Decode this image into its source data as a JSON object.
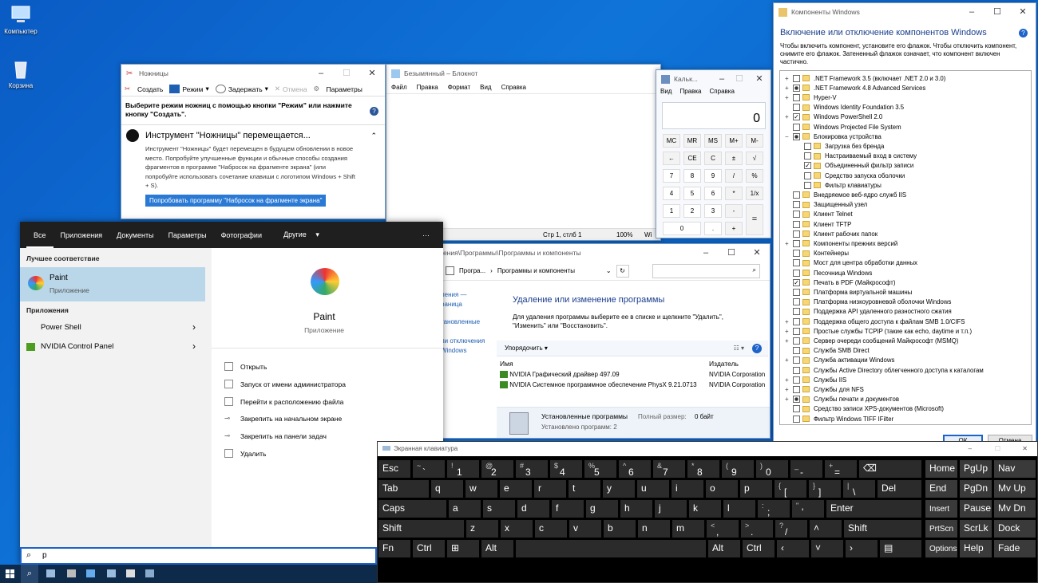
{
  "desktop": {
    "computer": "Компьютер",
    "recycle": "Корзина"
  },
  "snipping": {
    "title": "Ножницы",
    "create": "Создать",
    "mode": "Режим",
    "delay": "Задержать",
    "cancel": "Отмена",
    "options": "Параметры",
    "hint": "Выберите режим ножниц с помощью кнопки \"Режим\" или нажмите кнопку \"Создать\".",
    "moving_title": "Инструмент \"Ножницы\" перемещается...",
    "moving_text": "Инструмент \"Ножницы\" будет перемещен в будущем обновлении в новое место. Попробуйте улучшенные функции и обычные способы создания фрагментов в программе \"Набросок на фрагменте экрана\" (или попробуйте использовать сочетание клавиши с логотипом Windows + Shift + S).",
    "try_button": "Попробовать программу \"Набросок на фрагменте экрана\""
  },
  "notepad": {
    "title": "Безымянный – Блокнот",
    "menu": [
      "Файл",
      "Правка",
      "Формат",
      "Вид",
      "Справка"
    ],
    "status_pos": "Стр 1, стлб 1",
    "zoom": "100%",
    "enc": "Wi"
  },
  "calc": {
    "title": "Кальк...",
    "menu": [
      "Вид",
      "Правка",
      "Справка"
    ],
    "display": "0",
    "keys": [
      [
        "MC",
        "MR",
        "MS",
        "M+",
        "M-"
      ],
      [
        "←",
        "CE",
        "C",
        "±",
        "√"
      ],
      [
        "7",
        "8",
        "9",
        "/",
        "%"
      ],
      [
        "4",
        "5",
        "6",
        "*",
        "1/x"
      ],
      [
        "1",
        "2",
        "3",
        "-",
        "="
      ],
      [
        "0",
        ".",
        "+"
      ]
    ]
  },
  "features": {
    "title": "Компоненты Windows",
    "heading": "Включение или отключение компонентов Windows",
    "desc": "Чтобы включить компонент, установите его флажок. Чтобы отключить компонент, снимите его флажок. Затененный флажок означает, что компонент включен частично.",
    "ok": "ОК",
    "cancel": "Отмена",
    "items": [
      {
        "exp": "+",
        "state": "off",
        "label": ".NET Framework 3.5 (включает .NET 2.0 и 3.0)"
      },
      {
        "exp": "+",
        "state": "part",
        "label": ".NET Framework 4.8 Advanced Services"
      },
      {
        "exp": "+",
        "state": "off",
        "label": "Hyper-V"
      },
      {
        "exp": "",
        "state": "off",
        "label": "Windows Identity Foundation 3.5"
      },
      {
        "exp": "+",
        "state": "on",
        "label": "Windows PowerShell 2.0"
      },
      {
        "exp": "",
        "state": "off",
        "label": "Windows Projected File System"
      },
      {
        "exp": "−",
        "state": "part",
        "label": "Блокировка устройства"
      },
      {
        "exp": "",
        "state": "off",
        "label": "Загрузка без бренда",
        "indent": true
      },
      {
        "exp": "",
        "state": "off",
        "label": "Настраиваемый вход в систему",
        "indent": true
      },
      {
        "exp": "",
        "state": "on",
        "label": "Объединенный фильтр записи",
        "indent": true
      },
      {
        "exp": "",
        "state": "off",
        "label": "Средство запуска оболочки",
        "indent": true
      },
      {
        "exp": "",
        "state": "off",
        "label": "Фильтр клавиатуры",
        "indent": true
      },
      {
        "exp": "",
        "state": "off",
        "label": "Внедряемое веб-ядро служб IIS"
      },
      {
        "exp": "",
        "state": "off",
        "label": "Защищенный узел"
      },
      {
        "exp": "",
        "state": "off",
        "label": "Клиент Telnet"
      },
      {
        "exp": "",
        "state": "off",
        "label": "Клиент TFTP"
      },
      {
        "exp": "",
        "state": "off",
        "label": "Клиент рабочих папок"
      },
      {
        "exp": "+",
        "state": "off",
        "label": "Компоненты прежних версий"
      },
      {
        "exp": "",
        "state": "off",
        "label": "Контейнеры"
      },
      {
        "exp": "",
        "state": "off",
        "label": "Мост для центра обработки данных"
      },
      {
        "exp": "",
        "state": "off",
        "label": "Песочница Windows"
      },
      {
        "exp": "",
        "state": "on",
        "label": "Печать в PDF (Майкрософт)"
      },
      {
        "exp": "",
        "state": "off",
        "label": "Платформа виртуальной машины"
      },
      {
        "exp": "",
        "state": "off",
        "label": "Платформа низкоуровневой оболочки Windows"
      },
      {
        "exp": "",
        "state": "off",
        "label": "Поддержка API удаленного разностного сжатия"
      },
      {
        "exp": "+",
        "state": "off",
        "label": "Поддержка общего доступа к файлам SMB 1.0/CIFS"
      },
      {
        "exp": "+",
        "state": "off",
        "label": "Простые службы TCPIP (такие как echo, daytime и т.п.)"
      },
      {
        "exp": "+",
        "state": "off",
        "label": "Сервер очереди сообщений Майкрософт (MSMQ)"
      },
      {
        "exp": "",
        "state": "off",
        "label": "Служба SMB Direct"
      },
      {
        "exp": "+",
        "state": "off",
        "label": "Служба активации Windows"
      },
      {
        "exp": "",
        "state": "off",
        "label": "Службы Active Directory облегченного доступа к каталогам"
      },
      {
        "exp": "+",
        "state": "off",
        "label": "Службы IIS"
      },
      {
        "exp": "+",
        "state": "off",
        "label": "Службы для NFS"
      },
      {
        "exp": "+",
        "state": "part",
        "label": "Службы печати и документов"
      },
      {
        "exp": "",
        "state": "off",
        "label": "Средство записи XPS-документов (Microsoft)"
      },
      {
        "exp": "",
        "state": "off",
        "label": "Фильтр Windows TIFF IFilter"
      }
    ]
  },
  "programs": {
    "title": "ления\\Программы\\Программы и компоненты",
    "bc1": "Програ...",
    "bc2": "Программы и компоненты",
    "side": [
      "ления —",
      "раница",
      "тановленные",
      "ли отключения",
      "Windows"
    ],
    "heading": "Удаление или изменение программы",
    "desc": "Для удаления программы выберите ее в списке и щелкните \"Удалить\", \"Изменить\" или \"Восстановить\".",
    "organize": "Упорядочить",
    "col_name": "Имя",
    "col_pub": "Издатель",
    "rows": [
      {
        "name": "NVIDIA Графический драйвер 497.09",
        "pub": "NVIDIA Corporation"
      },
      {
        "name": "NVIDIA Системное программное обеспечение PhysX 9.21.0713",
        "pub": "NVIDIA Corporation"
      }
    ],
    "installed": "Установленные программы",
    "total_label": "Полный размер:",
    "total": "0 байт",
    "count": "Установлено программ: 2"
  },
  "start": {
    "tabs": [
      "Все",
      "Приложения",
      "Документы",
      "Параметры",
      "Фотографии",
      "Другие"
    ],
    "more": "···",
    "best_label": "Лучшее соответствие",
    "best_name": "Paint",
    "best_type": "Приложение",
    "apps_label": "Приложения",
    "apps": [
      "Power Shell",
      "NVIDIA Control Panel"
    ],
    "detail_name": "Paint",
    "detail_type": "Приложение",
    "actions": [
      "Открыть",
      "Запуск от имени администратора",
      "Перейти к расположению файла",
      "Закрепить на начальном экране",
      "Закрепить на панели задач",
      "Удалить"
    ],
    "query": "p"
  },
  "osk": {
    "title": "Экранная клавиатура"
  }
}
